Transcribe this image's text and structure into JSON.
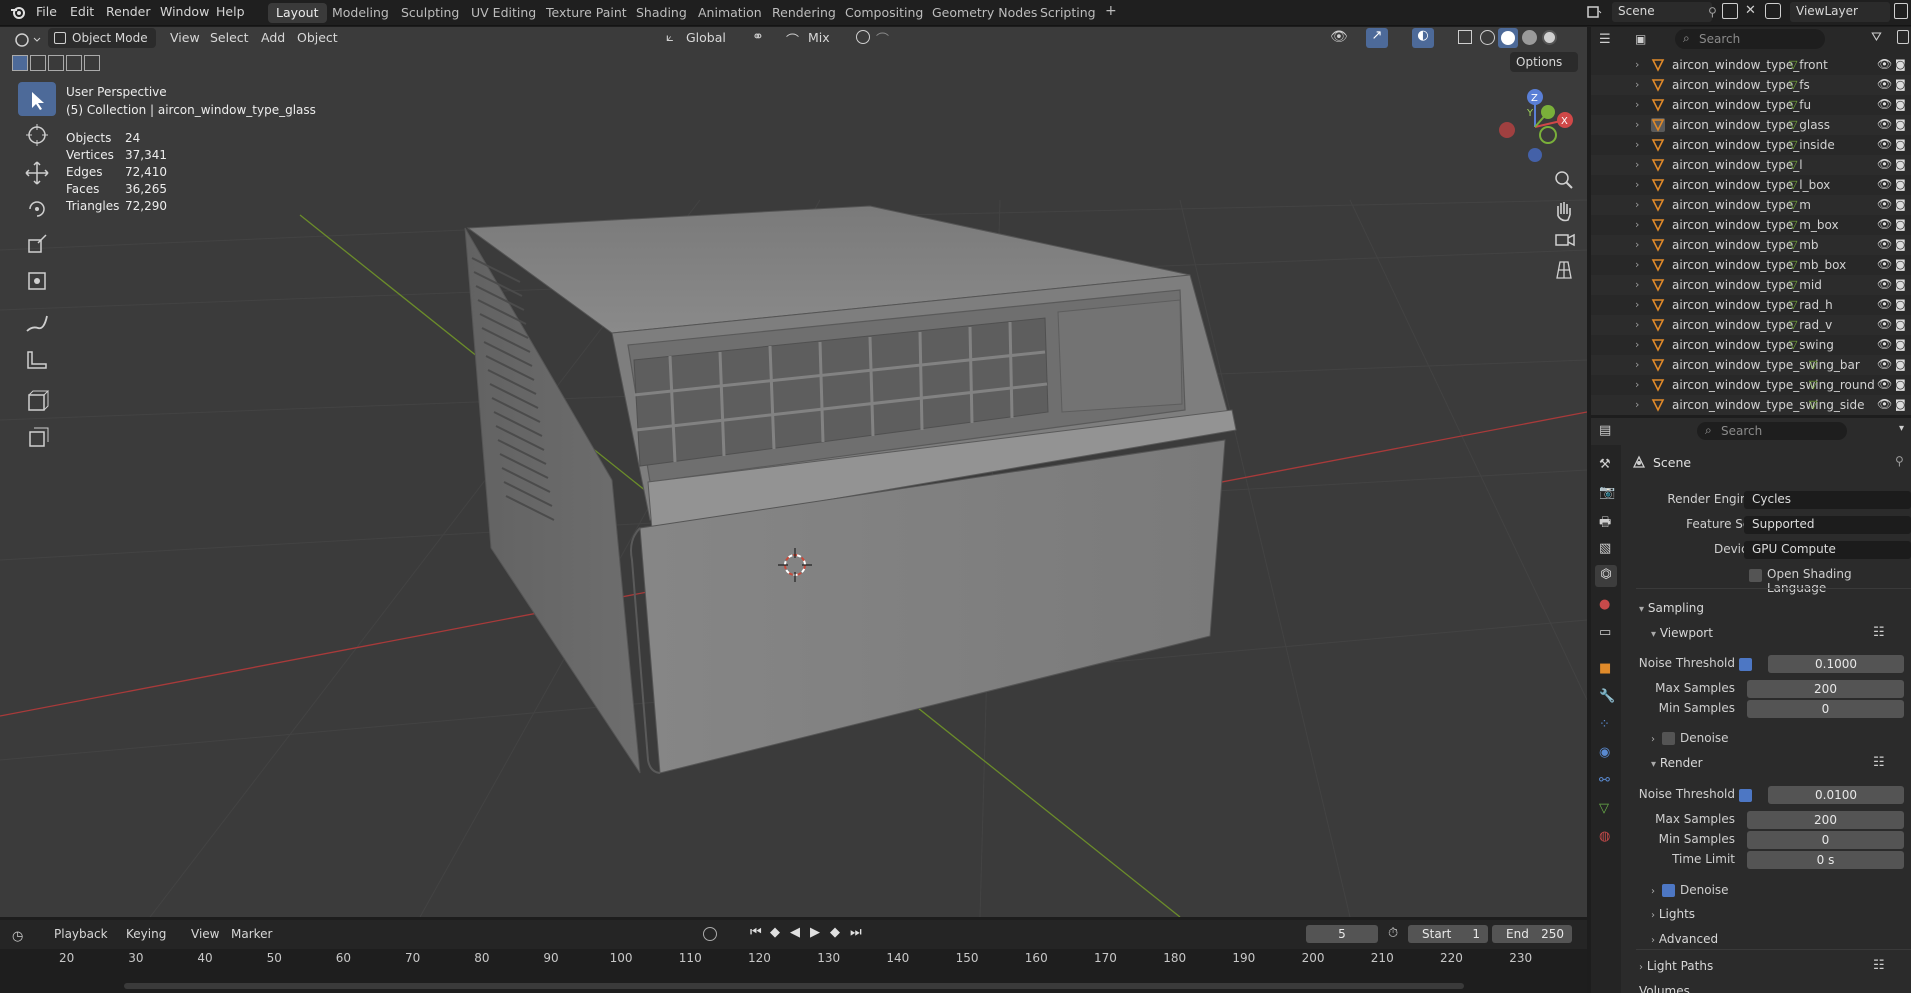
{
  "topbar": {
    "menus": [
      "File",
      "Edit",
      "Render",
      "Window",
      "Help"
    ],
    "workspaces": [
      "Layout",
      "Modeling",
      "Sculpting",
      "UV Editing",
      "Texture Paint",
      "Shading",
      "Animation",
      "Rendering",
      "Compositing",
      "Geometry Nodes",
      "Scripting"
    ],
    "active_workspace": "Layout",
    "add_workspace": "+",
    "scene_name": "Scene",
    "view_layer": "ViewLayer"
  },
  "viewport_header": {
    "mode": "Object Mode",
    "menus": [
      "View",
      "Select",
      "Add",
      "Object"
    ],
    "orientation": "Global",
    "snap_mode": "Mix",
    "options_label": "Options"
  },
  "overlay": {
    "perspective": "User Perspective",
    "collection": "(5) Collection | aircon_window_type_glass",
    "stats": [
      {
        "label": "Objects",
        "value": "24"
      },
      {
        "label": "Vertices",
        "value": "37,341"
      },
      {
        "label": "Edges",
        "value": "72,410"
      },
      {
        "label": "Faces",
        "value": "36,265"
      },
      {
        "label": "Triangles",
        "value": "72,290"
      }
    ],
    "gizmo_axes": {
      "z": "Z",
      "y": "Y",
      "x": "X"
    }
  },
  "outliner": {
    "items": [
      "aircon_window_type_front",
      "aircon_window_type_fs",
      "aircon_window_type_fu",
      "aircon_window_type_glass",
      "aircon_window_type_inside",
      "aircon_window_type_l",
      "aircon_window_type_l_box",
      "aircon_window_type_m",
      "aircon_window_type_m_box",
      "aircon_window_type_mb",
      "aircon_window_type_mb_box",
      "aircon_window_type_mid",
      "aircon_window_type_rad_h",
      "aircon_window_type_rad_v",
      "aircon_window_type_swing",
      "aircon_window_type_swing_bar",
      "aircon_window_type_swing_round",
      "aircon_window_type_swing_side"
    ],
    "search_placeholder": "Search"
  },
  "properties": {
    "search_placeholder": "Search",
    "context": "Scene",
    "render_engine_label": "Render Engine",
    "render_engine": "Cycles",
    "feature_set_label": "Feature Set",
    "feature_set": "Supported",
    "device_label": "Device",
    "device": "GPU Compute",
    "osl_label": "Open Shading Language",
    "sampling": "Sampling",
    "viewport": "Viewport",
    "render": "Render",
    "noise_threshold_label": "Noise Threshold",
    "max_samples_label": "Max Samples",
    "min_samples_label": "Min Samples",
    "time_limit_label": "Time Limit",
    "denoise_label": "Denoise",
    "vp_noise_threshold": "0.1000",
    "vp_max_samples": "200",
    "vp_min_samples": "0",
    "r_noise_threshold": "0.0100",
    "r_max_samples": "200",
    "r_min_samples": "0",
    "r_time_limit": "0 s",
    "lights": "Lights",
    "advanced": "Advanced",
    "light_paths": "Light Paths",
    "volumes": "Volumes"
  },
  "timeline": {
    "menus": [
      "Playback",
      "Keying",
      "View",
      "Marker"
    ],
    "current_frame": "5",
    "start_label": "Start",
    "start": "1",
    "end_label": "End",
    "end": "250",
    "ticks": [
      "20",
      "30",
      "40",
      "50",
      "60",
      "70",
      "80",
      "90",
      "100",
      "110",
      "120",
      "130",
      "140",
      "150",
      "160",
      "170",
      "180",
      "190",
      "200",
      "210",
      "220",
      "230"
    ]
  }
}
